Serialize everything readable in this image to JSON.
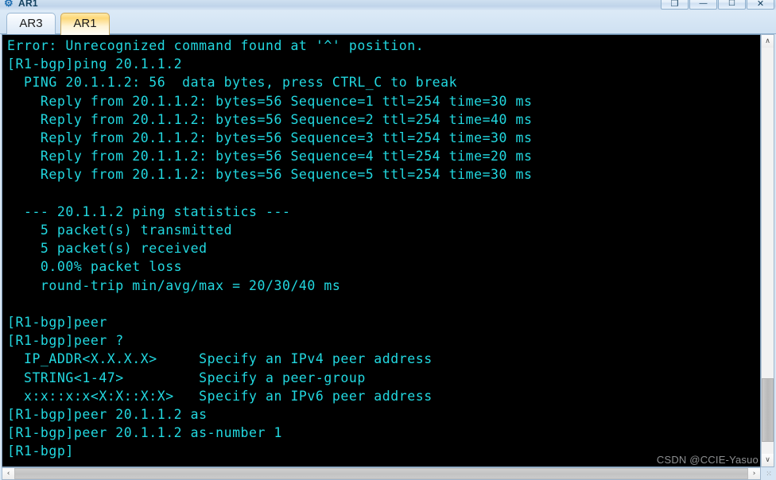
{
  "window": {
    "title": "AR1",
    "icon": "router-icon",
    "controls": [
      {
        "name": "restore-button",
        "glyph": "❐"
      },
      {
        "name": "minimize-button",
        "glyph": "—"
      },
      {
        "name": "maximize-button",
        "glyph": "☐"
      },
      {
        "name": "close-button",
        "glyph": "✕"
      }
    ]
  },
  "tabs": [
    {
      "label": "AR3",
      "active": false
    },
    {
      "label": "AR1",
      "active": true
    }
  ],
  "terminal": {
    "foreground_color": "#22d8e0",
    "background_color": "#000000",
    "lines": [
      "Error: Unrecognized command found at '^' position.",
      "[R1-bgp]ping 20.1.1.2",
      "  PING 20.1.1.2: 56  data bytes, press CTRL_C to break",
      "    Reply from 20.1.1.2: bytes=56 Sequence=1 ttl=254 time=30 ms",
      "    Reply from 20.1.1.2: bytes=56 Sequence=2 ttl=254 time=40 ms",
      "    Reply from 20.1.1.2: bytes=56 Sequence=3 ttl=254 time=30 ms",
      "    Reply from 20.1.1.2: bytes=56 Sequence=4 ttl=254 time=20 ms",
      "    Reply from 20.1.1.2: bytes=56 Sequence=5 ttl=254 time=30 ms",
      "",
      "  --- 20.1.1.2 ping statistics ---",
      "    5 packet(s) transmitted",
      "    5 packet(s) received",
      "    0.00% packet loss",
      "    round-trip min/avg/max = 20/30/40 ms",
      "",
      "[R1-bgp]peer",
      "[R1-bgp]peer ?",
      "  IP_ADDR<X.X.X.X>     Specify an IPv4 peer address",
      "  STRING<1-47>         Specify a peer-group",
      "  x:x::x:x<X:X::X:X>   Specify an IPv6 peer address",
      "[R1-bgp]peer 20.1.1.2 as",
      "[R1-bgp]peer 20.1.1.2 as-number 1",
      "[R1-bgp]"
    ]
  },
  "scrollbars": {
    "vertical": {
      "up_arrow": "∧",
      "down_arrow": "∨"
    },
    "horizontal": {
      "left_arrow": "‹",
      "right_arrow": "›"
    },
    "resize_grip": "⁙"
  },
  "watermark": {
    "text": "CSDN @CCIE-Yasuo"
  }
}
